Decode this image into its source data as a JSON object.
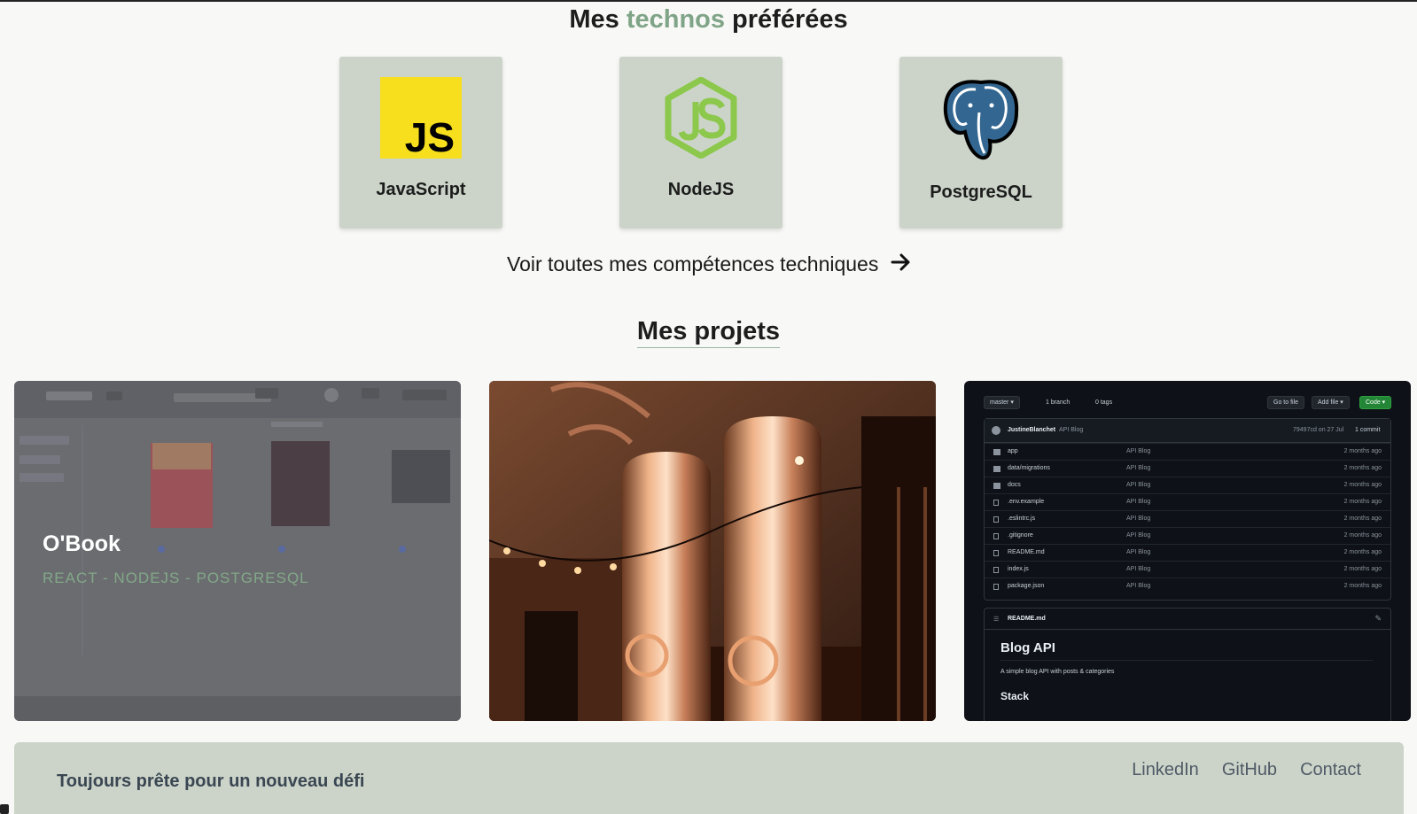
{
  "techs": {
    "title_before": "Mes ",
    "title_accent": "technos",
    "title_after": " préférées",
    "items": [
      {
        "label": "JavaScript",
        "icon": "javascript-logo-icon"
      },
      {
        "label": "NodeJS",
        "icon": "nodejs-logo-icon"
      },
      {
        "label": "PostgreSQL",
        "icon": "postgresql-elephant-icon"
      }
    ],
    "see_all": "Voir toutes mes compétences techniques",
    "see_all_icon": "arrow-right-icon",
    "js_logo_text": "JS"
  },
  "projects": {
    "title": "Mes projets",
    "items": [
      {
        "title": "O'Book",
        "tags": "REACT - NODEJS - POSTGRESQL"
      },
      {
        "image": "brewery-tanks-photo"
      },
      {
        "image": "github-repo-screenshot",
        "github": {
          "branch": "master",
          "branches": "1 branch",
          "tags": "0 tags",
          "go_to_file": "Go to file",
          "add_file": "Add file",
          "code": "Code",
          "author": "JustineBlanchet",
          "commit_msg": "API Blog",
          "commit_hash": "79497cd on 27 Jul",
          "commits": "1 commit",
          "files": [
            {
              "name": "app",
              "type": "folder",
              "msg": "API Blog",
              "age": "2 months ago"
            },
            {
              "name": "data/migrations",
              "type": "folder",
              "msg": "API Blog",
              "age": "2 months ago"
            },
            {
              "name": "docs",
              "type": "folder",
              "msg": "API Blog",
              "age": "2 months ago"
            },
            {
              "name": ".env.example",
              "type": "file",
              "msg": "API Blog",
              "age": "2 months ago"
            },
            {
              "name": ".eslintrc.js",
              "type": "file",
              "msg": "API Blog",
              "age": "2 months ago"
            },
            {
              "name": ".gitignore",
              "type": "file",
              "msg": "API Blog",
              "age": "2 months ago"
            },
            {
              "name": "README.md",
              "type": "file",
              "msg": "API Blog",
              "age": "2 months ago"
            },
            {
              "name": "index.js",
              "type": "file",
              "msg": "API Blog",
              "age": "2 months ago"
            },
            {
              "name": "package.json",
              "type": "file",
              "msg": "API Blog",
              "age": "2 months ago"
            }
          ],
          "readme_file": "README.md",
          "readme_title": "Blog API",
          "readme_desc": "A simple blog API with posts & categories",
          "readme_h2": "Stack"
        }
      }
    ]
  },
  "footer": {
    "tagline": "Toujours prête pour un nouveau défi",
    "links": [
      "LinkedIn",
      "GitHub",
      "Contact"
    ]
  },
  "colors": {
    "accent": "#7fa487",
    "card_bg": "#ccd4c9",
    "page_bg": "#f8f8f6",
    "js_yellow": "#f7df1e",
    "node_green": "#8cc84b",
    "pg_blue": "#336791"
  }
}
